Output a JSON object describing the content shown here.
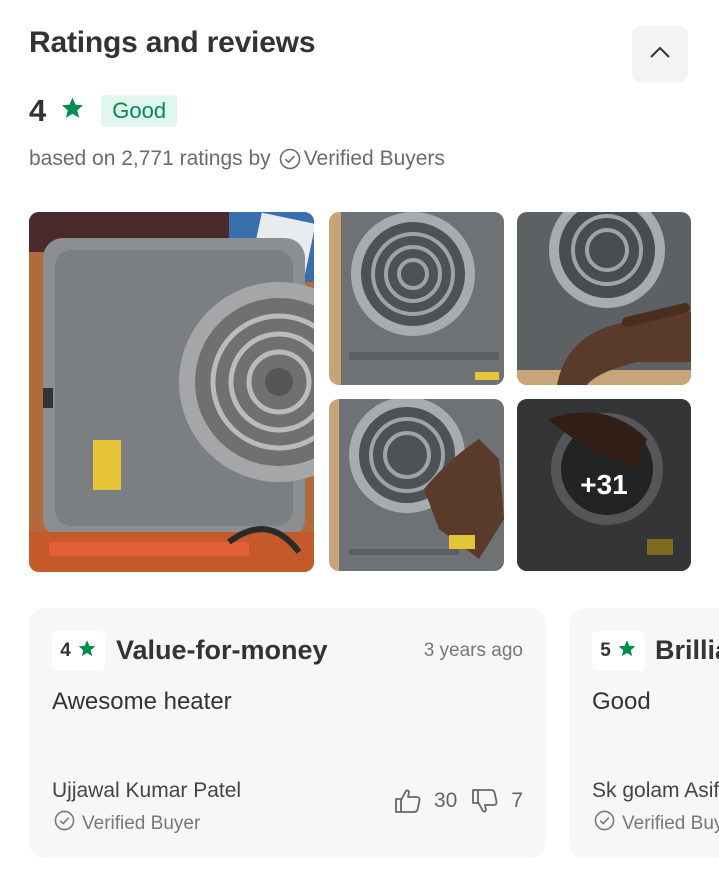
{
  "header": {
    "title": "Ratings and reviews",
    "collapse_icon": "chevron-up-icon"
  },
  "summary": {
    "rating": "4",
    "rating_label": "Good",
    "based_on": "based on 2,771 ratings by",
    "verified_label": "Verified Buyers",
    "star_color": "#008c4a",
    "badge_bg": "#e0f6ee"
  },
  "photos": {
    "more_count": "+31"
  },
  "reviews": [
    {
      "score": "4",
      "title": "Value-for-money",
      "date": "3 years ago",
      "body": "Awesome heater",
      "author": "Ujjawal Kumar Patel",
      "verified": "Verified Buyer",
      "likes": "30",
      "dislikes": "7"
    },
    {
      "score": "5",
      "title": "Brilliant",
      "body": "Good",
      "author": "Sk golam Asif",
      "verified": "Verified Buyer"
    }
  ]
}
